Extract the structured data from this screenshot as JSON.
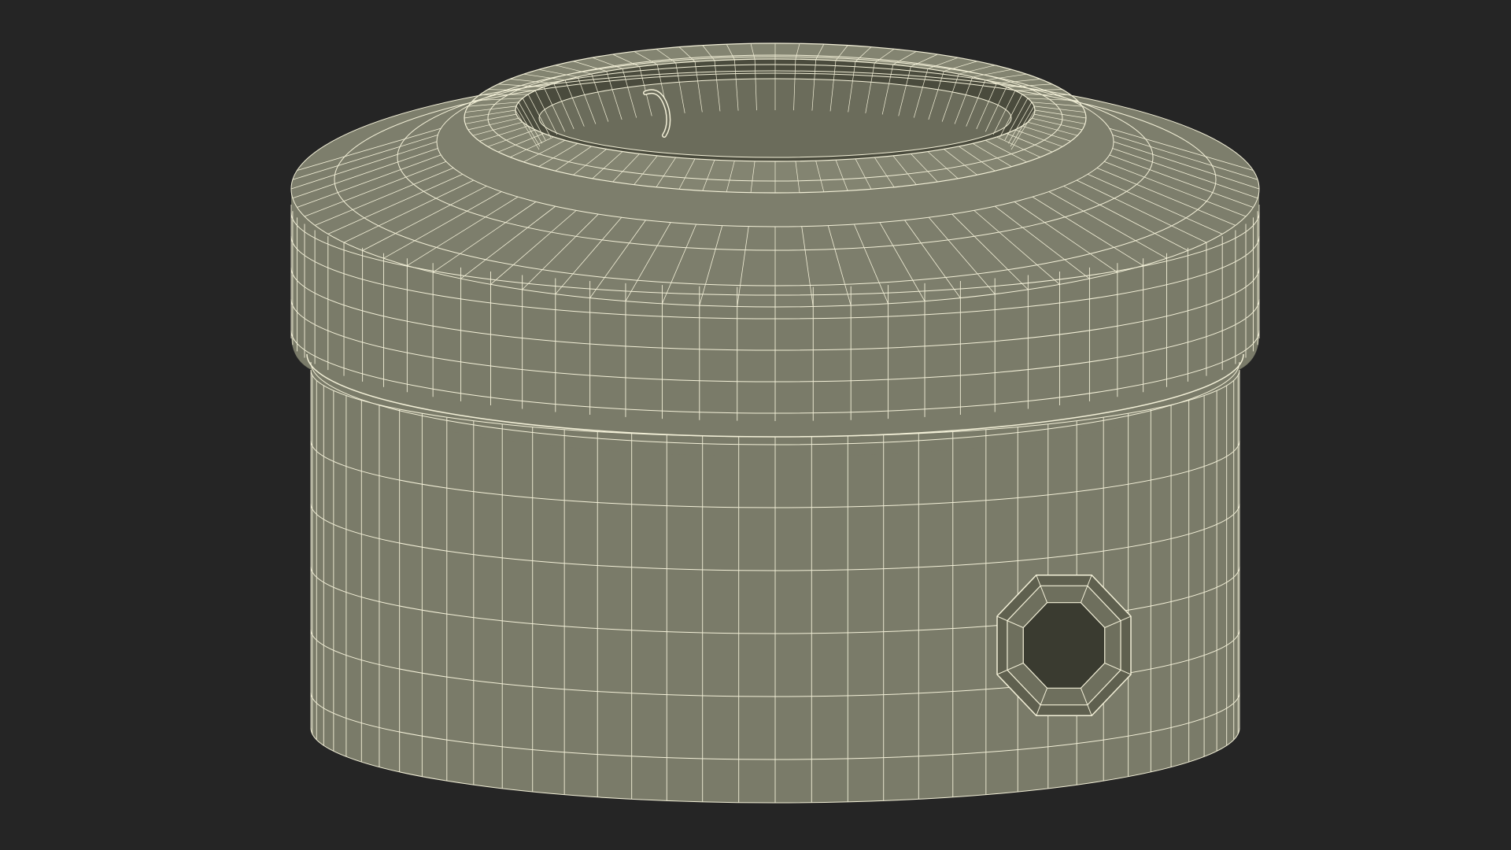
{
  "scene": {
    "kind": "wireframe-render",
    "subject": "cylindrical-box-with-lid",
    "background_color": "#252525",
    "surface_color": "#7a7b69",
    "surface_dark_color": "#5f604f",
    "wire_color": "#f3f0d8",
    "interior_color": "#4a4b3d",
    "hole_color": "#3a3b30"
  }
}
